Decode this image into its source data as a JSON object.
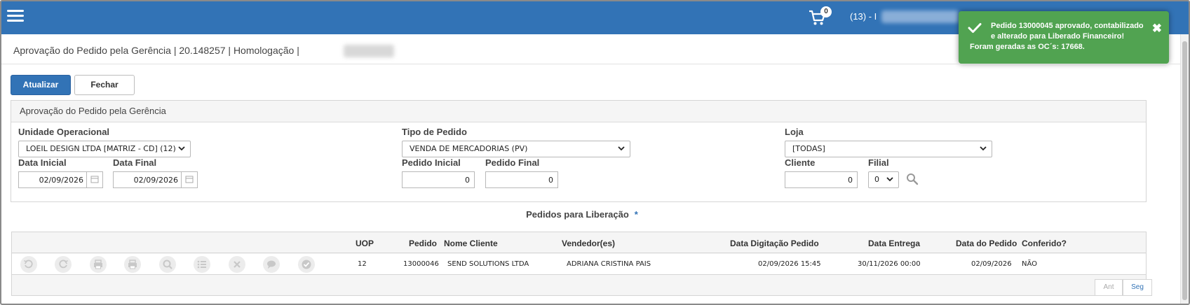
{
  "header": {
    "cart_count": "0",
    "user_label": "(13) - I",
    "accent_color": "#3273b6"
  },
  "toast": {
    "line1": "Pedido 13000045 aprovado, contabilizado",
    "line2": "e alterado para Liberado Financeiro!",
    "line3": "Foram geradas as OC´s: 17668.",
    "close": "✖",
    "color": "#51a351"
  },
  "page": {
    "title": "Aprovação do Pedido pela Gerência | 20.148257 | Homologação |"
  },
  "actions": {
    "update_label": "Atualizar",
    "close_label": "Fechar"
  },
  "filters": {
    "panel_title": "Aprovação do Pedido pela Gerência",
    "unidade_label": "Unidade Operacional",
    "unidade_value": "LOEIL DESIGN LTDA [MATRIZ - CD] (12)",
    "tipo_label": "Tipo de Pedido",
    "tipo_value": "VENDA DE MERCADORIAS (PV)",
    "loja_label": "Loja",
    "loja_value": "[TODAS]",
    "data_inicial_label": "Data Inicial",
    "data_inicial_value": "02/09/2026",
    "data_final_label": "Data Final",
    "data_final_value": "02/09/2026",
    "pedido_inicial_label": "Pedido Inicial",
    "pedido_inicial_value": "0",
    "pedido_final_label": "Pedido Final",
    "pedido_final_value": "0",
    "cliente_label": "Cliente",
    "cliente_value": "0",
    "filial_label": "Filial",
    "filial_value": "0"
  },
  "list": {
    "title": "Pedidos para Liberação",
    "star": "*",
    "columns": [
      "UOP",
      "Pedido",
      "Nome Cliente",
      "Vendedor(es)",
      "Data Digitação Pedido",
      "Data Entrega",
      "Data do Pedido",
      "Conferido?"
    ],
    "rows": [
      {
        "uop": "12",
        "pedido": "13000046",
        "cliente": "SEND SOLUTIONS LTDA",
        "vendedor": "ADRIANA CRISTINA PAIS",
        "data_digitacao": "02/09/2026 15:45",
        "data_entrega": "30/11/2026 00:00",
        "data_pedido": "02/09/2026",
        "conferido": "NÃO"
      }
    ],
    "row_icons": [
      "undo-icon",
      "redo-icon",
      "print-icon",
      "print-alt-icon",
      "zoom-icon",
      "list-icon",
      "cancel-icon",
      "comment-icon",
      "approve-icon"
    ],
    "pager_prev": "Ant",
    "pager_next": "Seg"
  }
}
